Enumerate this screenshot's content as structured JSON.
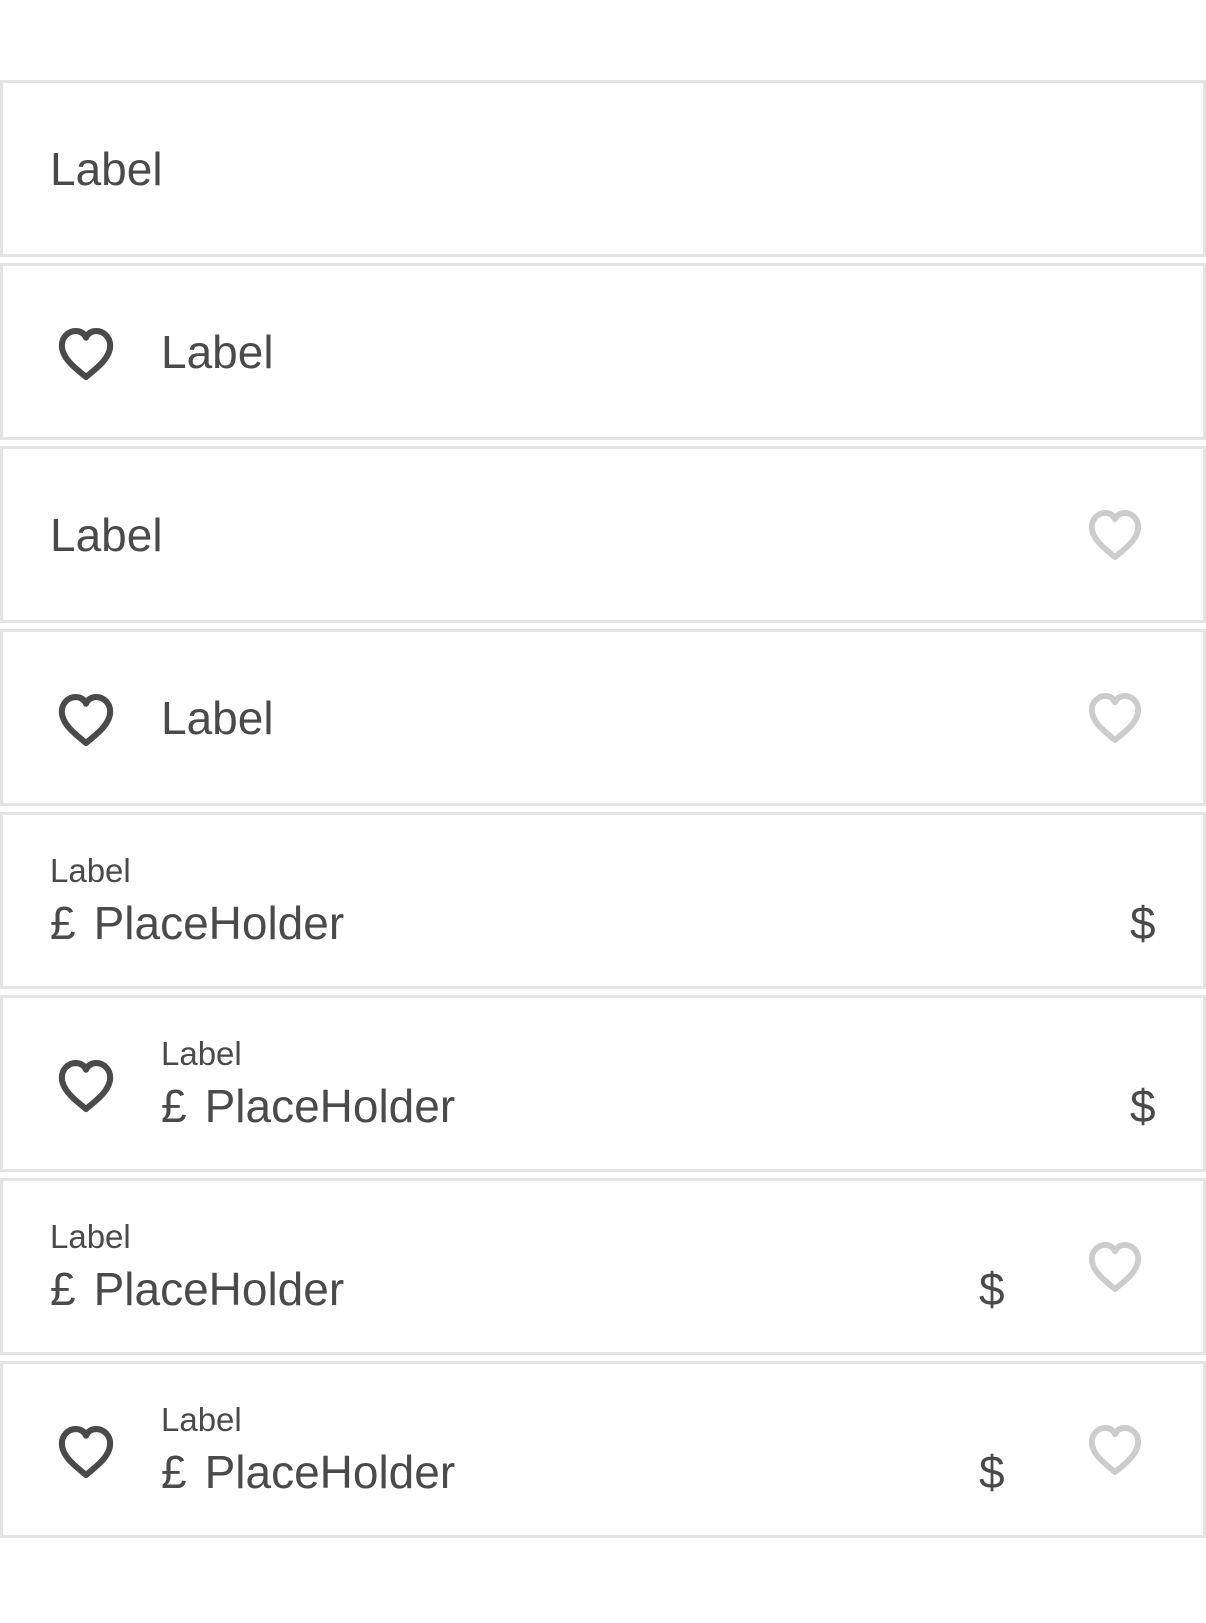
{
  "icons": {
    "leading": "heart-outline-icon",
    "trailing": "heart-outline-icon",
    "leading_color": "#4a4a4a",
    "trailing_color": "#cccccc"
  },
  "fields": [
    {
      "label": "Label"
    },
    {
      "label": "Label"
    },
    {
      "label": "Label"
    },
    {
      "label": "Label"
    },
    {
      "label": "Label",
      "prefix": "£",
      "placeholder": "PlaceHolder",
      "suffix": "$"
    },
    {
      "label": "Label",
      "prefix": "£",
      "placeholder": "PlaceHolder",
      "suffix": "$"
    },
    {
      "label": "Label",
      "prefix": "£",
      "placeholder": "PlaceHolder",
      "suffix": "$"
    },
    {
      "label": "Label",
      "prefix": "£",
      "placeholder": "PlaceHolder",
      "suffix": "$"
    }
  ]
}
